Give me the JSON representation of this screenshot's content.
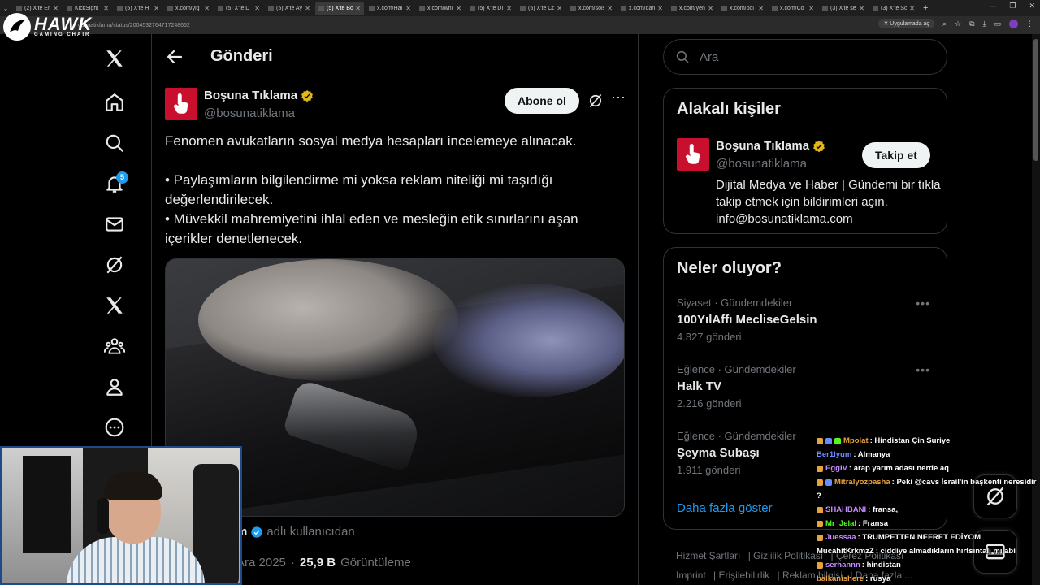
{
  "browser": {
    "tabs": [
      {
        "label": "(2) X'te En",
        "active": false
      },
      {
        "label": "KickSight",
        "active": false
      },
      {
        "label": "(5) X'te H",
        "active": false
      },
      {
        "label": "x.com/yig",
        "active": false
      },
      {
        "label": "(5) X'te D",
        "active": false
      },
      {
        "label": "(5) X'te Ay",
        "active": false
      },
      {
        "label": "(5) X'te Bo",
        "active": true
      },
      {
        "label": "x.com/Hal",
        "active": false
      },
      {
        "label": "x.com/whi",
        "active": false
      },
      {
        "label": "(5) X'te Dı",
        "active": false
      },
      {
        "label": "(5) X'te Co",
        "active": false
      },
      {
        "label": "x.com/sols",
        "active": false
      },
      {
        "label": "x.com/dan",
        "active": false
      },
      {
        "label": "x.com/yen",
        "active": false
      },
      {
        "label": "x.com/pol",
        "active": false
      },
      {
        "label": "x.com/Co",
        "active": false
      },
      {
        "label": "(3) X'te se",
        "active": false
      },
      {
        "label": "(3) X'te Sc",
        "active": false
      }
    ],
    "url": "osunatiklama/status/2004532764717248662",
    "app_pill": "Uygulamada aç"
  },
  "watermark": {
    "brand": "HAWK",
    "sub": "GAMING CHAIR"
  },
  "nav": {
    "notification_count": "5"
  },
  "header": {
    "title": "Gönderi"
  },
  "post": {
    "author_name": "Boşuna Tıklama",
    "author_handle": "@bosunatiklama",
    "subscribe_label": "Abone ol",
    "text_lines": [
      "Fenomen avukatların sosyal medya hesapları incelemeye alınacak.",
      "• Paylaşımların bilgilendirme mi yoksa reklam niteliği mi taşıdığı",
      "değerlendirilecek.",
      "• Müvekkil mahremiyetini ihlal eden ve mesleğin etik sınırlarını aşan",
      "içerikler denetlenecek."
    ],
    "quoted_name": "m",
    "quoted_suffix": "adlı kullanıcıdan",
    "date": "Ara 2025",
    "views": "25,9 B",
    "views_label": "Görüntüleme"
  },
  "search": {
    "placeholder": "Ara"
  },
  "related": {
    "title": "Alakalı kişiler",
    "name": "Boşuna Tıklama",
    "handle": "@bosunatiklama",
    "follow_label": "Takip et",
    "bio": "Dijital Medya ve Haber | Gündemi bir tıkla takip etmek için bildirimleri açın. info@bosunatiklama.com"
  },
  "trends": {
    "title": "Neler oluyor?",
    "items": [
      {
        "category": "Siyaset · Gündemdekiler",
        "name": "100YılAffı MecliseGelsin",
        "count": "4.827 gönderi"
      },
      {
        "category": "Eğlence · Gündemdekiler",
        "name": "Halk TV",
        "count": "2.216 gönderi"
      },
      {
        "category": "Eğlence · Gündemdekiler",
        "name": "Şeyma Subaşı",
        "count": "1.911 gönderi"
      }
    ],
    "show_more": "Daha fazla göster"
  },
  "footer": {
    "links": [
      "Hizmet Şartları",
      "Gizlilik Politikası",
      "Çerez Politikası",
      "Imprint",
      "Erişilebilirlik",
      "Reklam bilgisi",
      "Daha fazla ..."
    ]
  },
  "chat": [
    {
      "user": "Mpolat",
      "text": ": Hindistan Çin Suriye",
      "color": "#e8a33c",
      "badges": 3
    },
    {
      "user": "Ber1lyum",
      "text": ": Almanya",
      "color": "#6b8cff",
      "badges": 0
    },
    {
      "user": "EggIV",
      "text": ": arap yarım adası nerde aq",
      "color": "#c58bff",
      "badges": 1
    },
    {
      "user": "Mitralyozpasha",
      "text": ": Peki @cavs İsrail'in başkenti neresidir",
      "color": "#e8a33c",
      "badges": 2
    },
    {
      "user": "",
      "text": "?",
      "color": "#ffffff",
      "badges": 0
    },
    {
      "user": "SHAHBANI",
      "text": ": fransa,",
      "color": "#c58bff",
      "badges": 1
    },
    {
      "user": "Mr_Jelal",
      "text": ": Fransa",
      "color": "#53fc18",
      "badges": 1
    },
    {
      "user": "Juessaa",
      "text": ": TRUMPETTEN NEFRET EDİYOM",
      "color": "#c58bff",
      "badges": 1
    },
    {
      "user": "MucahitKrkmzZ",
      "text": ": ciddiye almadıkların hırtsıntalı mı abi",
      "color": "#ffffff",
      "badges": 0
    },
    {
      "user": "serhannn",
      "text": ": hindistan",
      "color": "#c58bff",
      "badges": 1
    },
    {
      "user": "balkanishere",
      "text": ": rusya",
      "color": "#e8a33c",
      "badges": 0
    }
  ],
  "colors": {
    "accent": "#1d9bf0",
    "brand_red": "#c8102e",
    "verified": "#e2b719"
  }
}
